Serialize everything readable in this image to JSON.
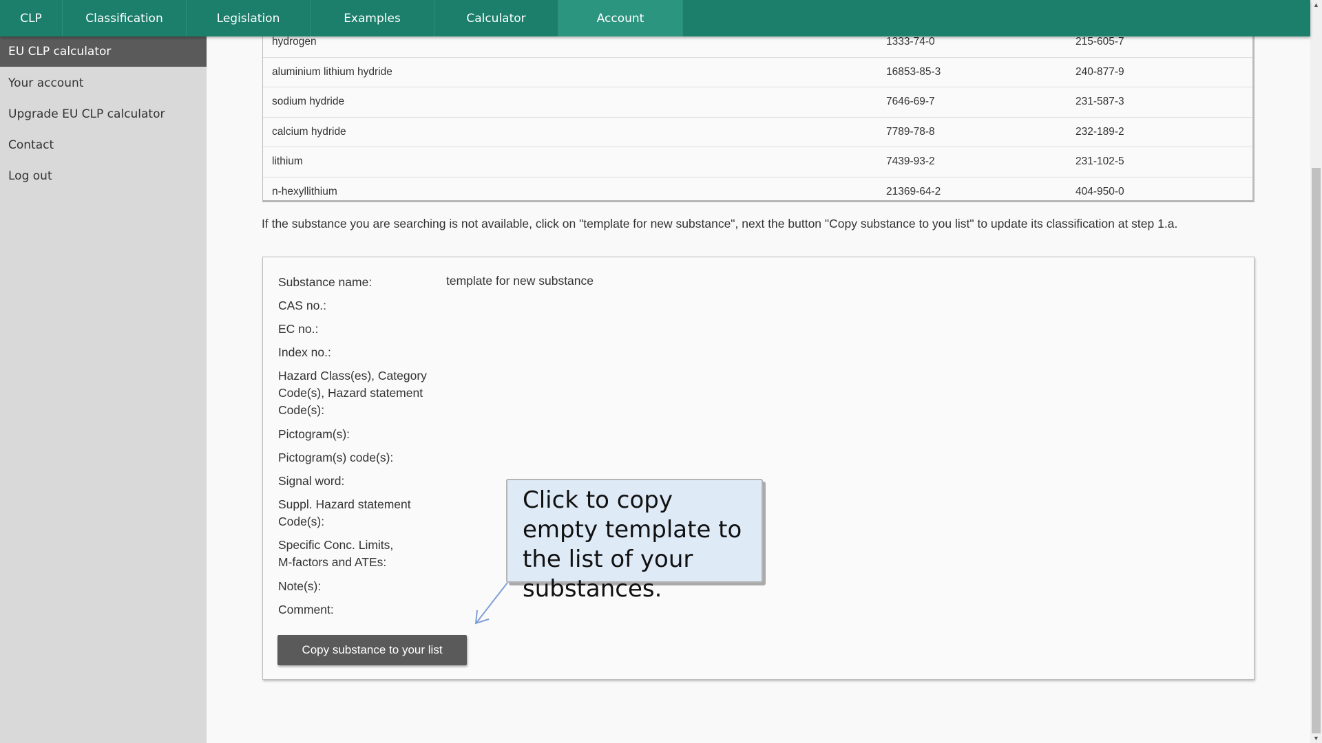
{
  "nav": {
    "tabs": [
      {
        "label": "CLP",
        "w": 91
      },
      {
        "label": "Classification"
      },
      {
        "label": "Legislation"
      },
      {
        "label": "Examples"
      },
      {
        "label": "Calculator"
      },
      {
        "label": "Account",
        "active": true
      }
    ]
  },
  "sidebar": {
    "items": [
      {
        "label": "EU CLP calculator",
        "active": true
      },
      {
        "label": "Your account"
      },
      {
        "label": "Upgrade EU CLP calculator"
      },
      {
        "label": "Contact"
      },
      {
        "label": "Log out"
      }
    ]
  },
  "table": {
    "rows": [
      {
        "name": "hydrogen",
        "cas": "1333-74-0",
        "ec": "215-605-7"
      },
      {
        "name": "aluminium lithium hydride",
        "cas": "16853-85-3",
        "ec": "240-877-9"
      },
      {
        "name": "sodium hydride",
        "cas": "7646-69-7",
        "ec": "231-587-3"
      },
      {
        "name": "calcium hydride",
        "cas": "7789-78-8",
        "ec": "232-189-2"
      },
      {
        "name": "lithium",
        "cas": "7439-93-2",
        "ec": "231-102-5"
      },
      {
        "name": "n-hexyllithium",
        "cas": "21369-64-2",
        "ec": "404-950-0"
      }
    ]
  },
  "info_text": "If the substance you are searching is not available, click on \"template for new substance\", next the button \"Copy substance to you list\" to update its classification at step 1.a.",
  "detail": {
    "substance_name_value": "template for new substance",
    "labels": [
      "Substance name:",
      "CAS no.:",
      "EC no.:",
      "Index no.:",
      "Hazard Class(es), Category Code(s), Hazard statement Code(s):",
      "Pictogram(s):",
      "Pictogram(s) code(s):",
      "Signal word:",
      "Suppl. Hazard statement Code(s):",
      "Specific Conc. Limits, M-factors and ATEs:",
      "Note(s):",
      "Comment:"
    ],
    "copy_button": "Copy substance to your list"
  },
  "callout": {
    "text": "Click to copy empty template to the list of your substances."
  },
  "colors": {
    "nav": "#1b7f6c",
    "nav_active": "#2c9580",
    "sidebar": "#d9d9d9",
    "sidebar_active": "#5a5a5a",
    "callout": "#dfeaf7",
    "arrow": "#7f9fd8"
  }
}
